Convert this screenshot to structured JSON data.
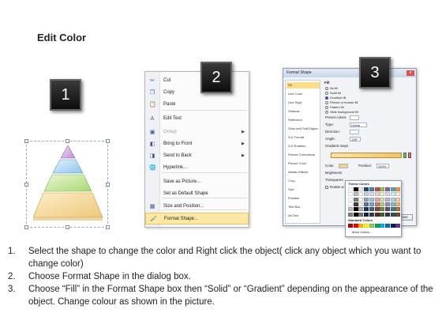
{
  "title": "Edit Color",
  "badges": [
    "1",
    "2",
    "3"
  ],
  "context_menu": {
    "items": [
      {
        "icon": "scissors-icon",
        "glyph": "✂",
        "label": "Cut",
        "submenu": false,
        "disabled": false
      },
      {
        "icon": "copy-icon",
        "glyph": "❐",
        "label": "Copy",
        "submenu": false,
        "disabled": false
      },
      {
        "icon": "paste-icon",
        "glyph": "📋",
        "label": "Paste",
        "submenu": false,
        "disabled": false
      },
      {
        "icon": "edit-text-icon",
        "glyph": "A",
        "label": "Edit Text",
        "submenu": false,
        "disabled": false
      },
      {
        "icon": "group-icon",
        "glyph": "▣",
        "label": "Group",
        "submenu": true,
        "disabled": true
      },
      {
        "icon": "bring-to-front-icon",
        "glyph": "◧",
        "label": "Bring to Front",
        "submenu": true,
        "disabled": false
      },
      {
        "icon": "send-to-back-icon",
        "glyph": "◨",
        "label": "Send to Back",
        "submenu": true,
        "disabled": false
      },
      {
        "icon": "hyperlink-icon",
        "glyph": "🌐",
        "label": "Hyperlink...",
        "submenu": false,
        "disabled": false
      },
      {
        "icon": "save-picture-icon",
        "glyph": "",
        "label": "Save as Picture...",
        "submenu": false,
        "disabled": false
      },
      {
        "icon": "default-shape-icon",
        "glyph": "",
        "label": "Set as Default Shape",
        "submenu": false,
        "disabled": false
      },
      {
        "icon": "size-position-icon",
        "glyph": "▦",
        "label": "Size and Position...",
        "submenu": false,
        "disabled": false
      },
      {
        "icon": "format-shape-icon",
        "glyph": "🖌",
        "label": "Format Shape...",
        "submenu": false,
        "disabled": false,
        "highlighted": true
      }
    ]
  },
  "format_dialog": {
    "title": "Format Shape",
    "close_glyph": "x",
    "sidebar": [
      "Fill",
      "Line Color",
      "Line Style",
      "Shadow",
      "Reflection",
      "Glow and Soft Edges",
      "3-D Format",
      "3-D Rotation",
      "Picture Corrections",
      "Picture Color",
      "Artistic Effects",
      "Crop",
      "Size",
      "Position",
      "Text Box",
      "Alt Text"
    ],
    "selected_sidebar": "Fill",
    "section": "Fill",
    "options": [
      "No fill",
      "Solid fill",
      "Gradient fill",
      "Picture or texture fill",
      "Pattern fill",
      "Slide background fill"
    ],
    "selected_option": "Gradient fill",
    "labels": {
      "preset": "Preset colors:",
      "type": "Type:",
      "type_value": "Linear",
      "direction": "Direction:",
      "angle": "Angle:",
      "angle_value": "135°",
      "stops": "Gradient stops",
      "color": "Color",
      "position": "Position:",
      "position_value": "100%",
      "brightness": "Brightness",
      "transparency": "Transparen",
      "rotate": "Rotate w",
      "theme_colors": "Theme Colors",
      "standard_colors": "Standard Colors",
      "more_colors": "More Colors...",
      "close": "Close"
    },
    "theme_palette": [
      "#ffffff",
      "#000000",
      "#eeece1",
      "#1f497d",
      "#4f81bd",
      "#c0504d",
      "#9bbb59",
      "#8064a2",
      "#4bacc6",
      "#f79646"
    ],
    "standard_palette": [
      "#c00000",
      "#ff0000",
      "#ffc000",
      "#ffff00",
      "#92d050",
      "#00b050",
      "#00b0f0",
      "#0070c0",
      "#002060",
      "#7030a0"
    ]
  },
  "instructions": [
    {
      "num": "1.",
      "text": "Select the shape to change the color and Right click the object( click any object which you want to change color)"
    },
    {
      "num": "2.",
      "text": "Choose Format Shape in the dialog box."
    },
    {
      "num": "3.",
      "text": "Choose “Fill” in the Format Shape box then “Solid” or “Gradient” depending on the appearance of the object. Change colour as shown in the picture."
    }
  ]
}
